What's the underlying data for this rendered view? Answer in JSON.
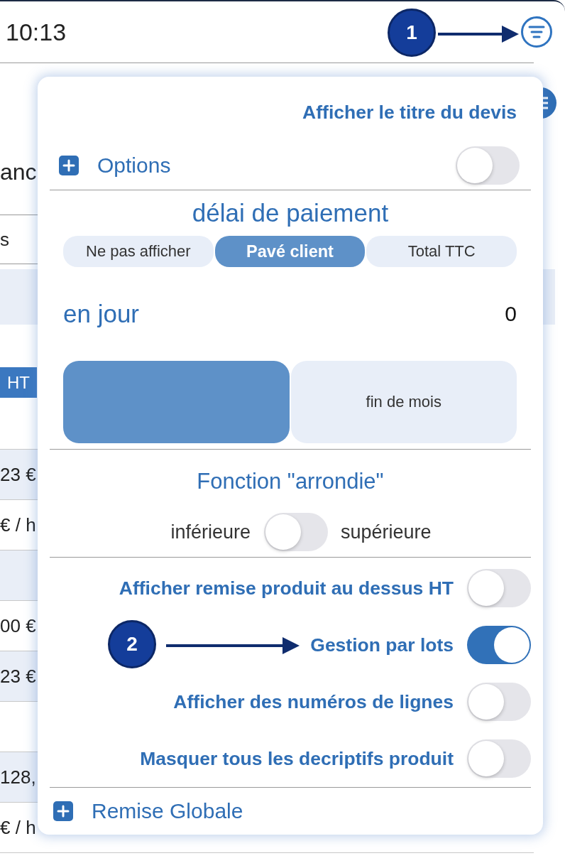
{
  "status_bar": {
    "time": "10:13"
  },
  "background": {
    "heading_fragment": "anc",
    "field_fragment": "s",
    "column_header_fragment": "HT",
    "rows": [
      {
        "kind": "value",
        "text": "23 €"
      },
      {
        "kind": "value",
        "text": "€ / h"
      },
      {
        "kind": "blank"
      },
      {
        "kind": "value",
        "text": "00 €"
      },
      {
        "kind": "value",
        "text": "23 €"
      },
      {
        "kind": "blank"
      },
      {
        "kind": "value",
        "text": "128,"
      },
      {
        "kind": "value",
        "text": "€ / h"
      }
    ]
  },
  "menu": {
    "title_option": "Afficher le titre du devis",
    "options": {
      "label": "Options",
      "on": false
    },
    "payment_delay": {
      "title": "délai de paiement",
      "display_segments": [
        {
          "label": "Ne pas afficher",
          "selected": false
        },
        {
          "label": "Pavé client",
          "selected": true
        },
        {
          "label": "Total TTC",
          "selected": false
        }
      ],
      "days_label": "en jour",
      "days_value": "0",
      "term_segments": [
        {
          "selected": true
        },
        {
          "label": "fin de mois",
          "selected": false
        }
      ]
    },
    "rounding": {
      "title": "Fonction \"arrondie\"",
      "lower_label": "inférieure",
      "upper_label": "supérieure",
      "on": false
    },
    "switches": [
      {
        "label": "Afficher remise produit au dessus HT",
        "on": false
      },
      {
        "label": "Gestion par lots",
        "on": true
      },
      {
        "label": "Afficher des numéros de lignes",
        "on": false
      },
      {
        "label": "Masquer tous les decriptifs produit",
        "on": false
      }
    ],
    "next_section": {
      "label": "Remise Globale"
    }
  },
  "callouts": [
    {
      "label": "1"
    },
    {
      "label": "2"
    }
  ]
}
